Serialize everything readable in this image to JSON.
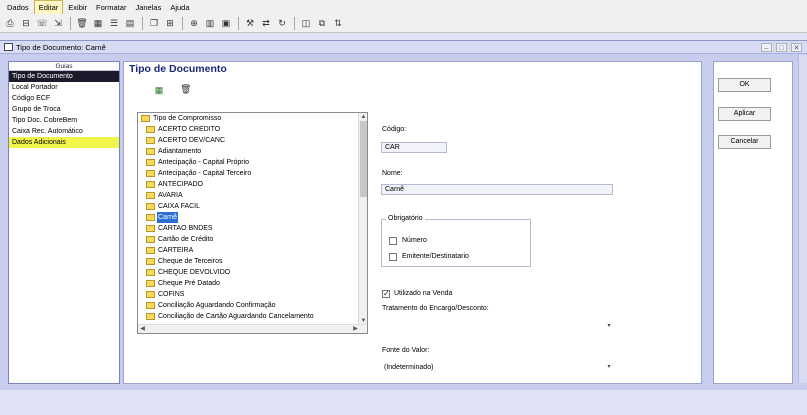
{
  "menu": [
    "Dados",
    "Editar",
    "Exibir",
    "Formatar",
    "Janelas",
    "Ajuda"
  ],
  "active_menu_index": 1,
  "toolbar_icons": [
    "print-icon",
    "print-preview-icon",
    "fax-icon",
    "export-icon",
    "delete-icon",
    "grid-icon",
    "list-icon",
    "form-icon",
    "window-icon",
    "filter-icon",
    "database-icon",
    "table-icon",
    "calculator-icon",
    "tools-icon",
    "transfer-icon",
    "refresh-icon",
    "save-icon",
    "copy-icon",
    "sort-icon"
  ],
  "window": {
    "title": "Tipo de Documento: Carnê",
    "buttons": [
      "minimize",
      "maximize",
      "close"
    ]
  },
  "guias": {
    "header": "Guias",
    "items": [
      "Tipo de Documento",
      "Local Portador",
      "Código ECF",
      "Grupo de Troca",
      "Tipo Doc. CobreBem",
      "Caixa Rec. Automático",
      "Dados Adicionais"
    ],
    "selected_index": 0,
    "highlighted_index": 6
  },
  "main": {
    "title": "Tipo de Documento",
    "tree": {
      "root": "Tipo de Compromisso",
      "items": [
        "ACERTO CREDITO",
        "ACERTO DEV/CANC",
        "Adiantamento",
        "Antecipação - Capital Próprio",
        "Antecipação - Capital Terceiro",
        "ANTECIPADO",
        "AVARIA",
        "CAIXA FACIL",
        "Carnê",
        "CARTAO BNDES",
        "Cartão de Crédito",
        "CARTEIRA",
        "Cheque de Terceiros",
        "CHEQUE DEVOLVIDO",
        "Cheque Pré Datado",
        "COFINS",
        "Conciliação Aguardando Confirmação",
        "Conciliação de Cartão Aguardando Cancelamento"
      ],
      "selected": "Carnê"
    },
    "form": {
      "codigo_label": "Código:",
      "codigo_value": "CAR",
      "nome_label": "Nome:",
      "nome_value": "Carnê",
      "obrigatorio_label": "Obrigatório",
      "numero_label": "Número",
      "numero_checked": false,
      "emitente_label": "Emitente/Destinatario",
      "emitente_checked": false,
      "utilizado_label": "Utilizado na Venda",
      "utilizado_checked": true,
      "tratamento_label": "Tratamento do Encargo/Desconto:",
      "tratamento_value": "",
      "fonte_label": "Fonte do Valor:",
      "fonte_value": "(Indeterminado)"
    }
  },
  "buttons": {
    "ok": "OK",
    "aplicar": "Aplicar",
    "cancelar": "Cancelar"
  }
}
